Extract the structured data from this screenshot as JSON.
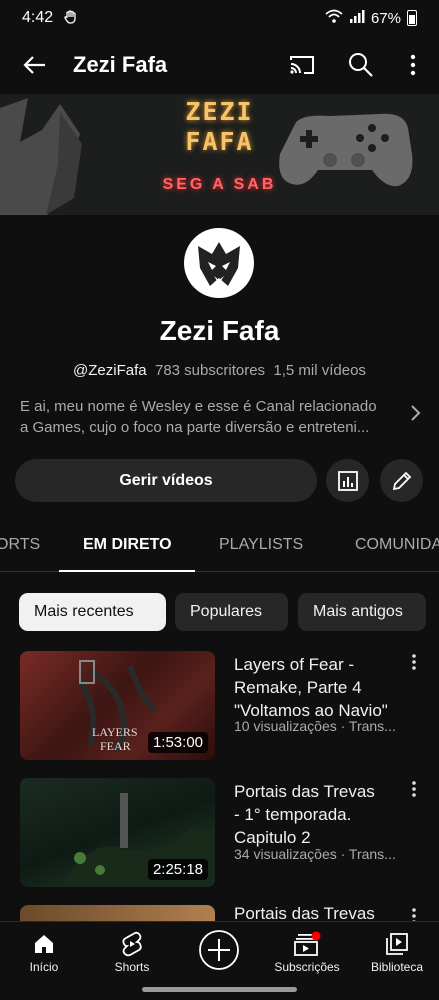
{
  "status_bar": {
    "time": "4:42",
    "battery": "67%"
  },
  "header": {
    "title": "Zezi Fafa"
  },
  "banner": {
    "line1": "ZEZI",
    "line2": "FAFA",
    "schedule": "SEG A SAB"
  },
  "channel": {
    "name": "Zezi Fafa",
    "handle": "@ZeziFafa",
    "subscribers": "783 subscritores",
    "videos": "1,5 mil vídeos",
    "description_line1": "E ai, meu nome é Wesley e esse é Canal relacionado",
    "description_line2": "a Games, cujo o foco na parte diversão e entreteni..."
  },
  "actions": {
    "manage_label": "Gerir vídeos"
  },
  "tabs": [
    "ORTS",
    "EM DIRETO",
    "PLAYLISTS",
    "COMUNIDA"
  ],
  "filters": [
    "Mais recentes",
    "Populares",
    "Mais antigos"
  ],
  "videos": [
    {
      "title_lines": [
        "Layers of Fear -",
        "Remake, Parte 4",
        "\"Voltamos ao Navio\""
      ],
      "meta": "10 visualizações · Trans...",
      "duration": "1:53:00",
      "thumb_text_1": "LAYERS",
      "thumb_text_2": "FEAR"
    },
    {
      "title_lines": [
        "Portais das Trevas",
        "- 1° temporada.",
        "Capitulo 2"
      ],
      "meta": "34 visualizações · Trans...",
      "duration": "2:25:18"
    },
    {
      "title_lines": [
        "Portais das Trevas"
      ]
    }
  ],
  "bottom_nav": [
    "Início",
    "Shorts",
    "Subscrições",
    "Biblioteca"
  ],
  "colors": {
    "background": "#0f0f0f",
    "chip": "#272727",
    "accent_red": "#ff0000",
    "banner_text": "#f6c46a",
    "banner_schedule": "#ff6666"
  }
}
